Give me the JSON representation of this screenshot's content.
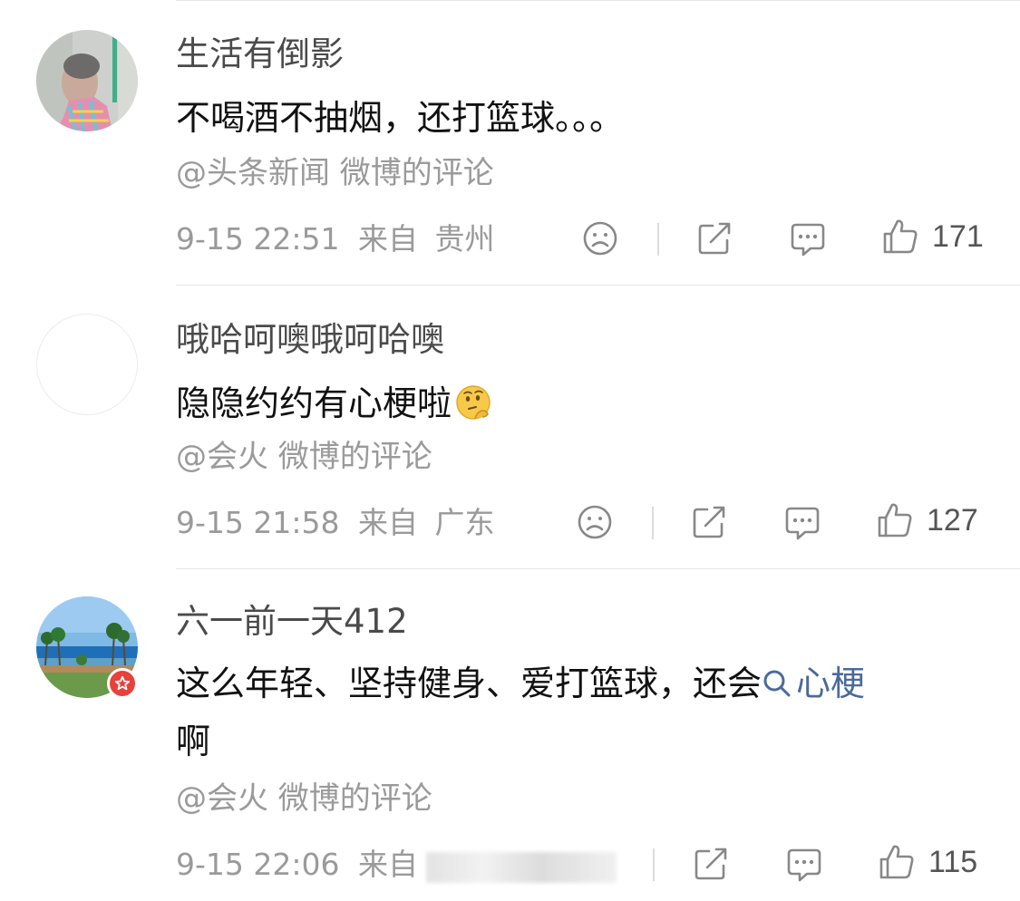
{
  "comments": [
    {
      "username": "生活有倒影",
      "text": "不喝酒不抽烟，还打篮球。。。",
      "source": "@头条新闻 微博的评论",
      "time": "9-15 22:51",
      "location_prefix": "来自",
      "location": "贵州",
      "likes": "171",
      "avatar": "photo"
    },
    {
      "username": "哦哈呵噢哦呵哈噢",
      "text": "隐隐约约有心梗啦",
      "emoji": "thinking-face-emoji",
      "source": "@会火 微博的评论",
      "time": "9-15 21:58",
      "location_prefix": "来自",
      "location": "广东",
      "likes": "127",
      "avatar": "blank"
    },
    {
      "username": "六一前一天412",
      "text": "这么年轻、坚持健身、爱打篮球，还会",
      "topic_link": "心梗",
      "text_end": "啊",
      "source": "@会火 微博的评论",
      "time": "9-15 22:06",
      "location_prefix": "来自",
      "location": "",
      "likes": "115",
      "avatar": "beach-photo",
      "badge": "verified-star-badge"
    }
  ],
  "colors": {
    "name": "#4a4a4a",
    "text": "#111111",
    "meta": "#9a9a9a",
    "link": "#4b6a9b",
    "badge": "#e8413b",
    "divider": "#e6e6e6"
  },
  "icons": [
    "sad-face-icon",
    "share-icon",
    "comment-icon",
    "like-icon",
    "search-icon"
  ]
}
